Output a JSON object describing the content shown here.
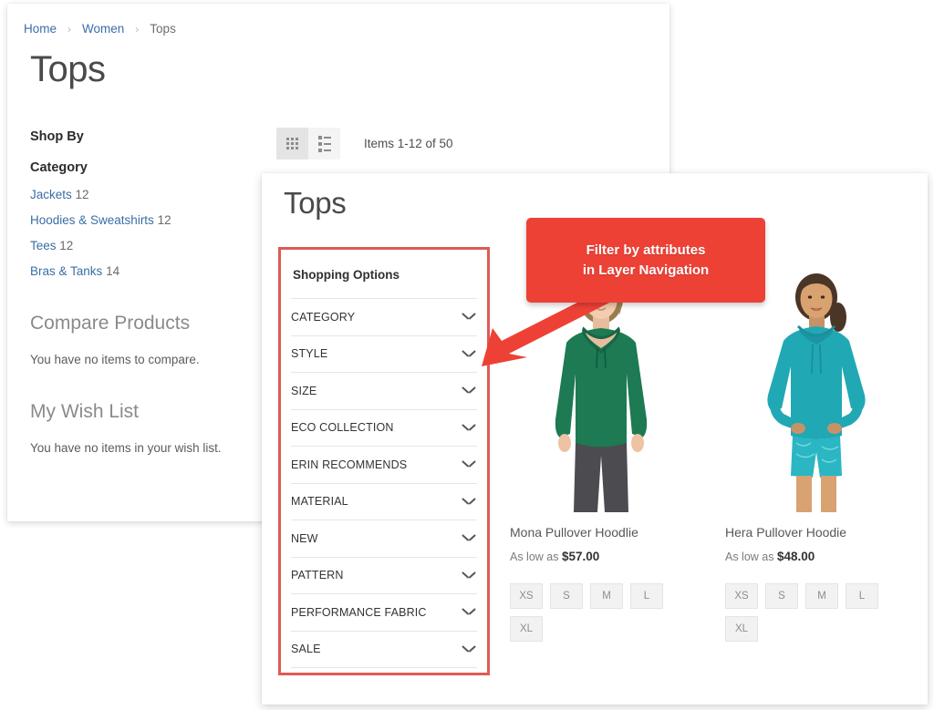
{
  "back_page": {
    "breadcrumb": {
      "items": [
        {
          "label": "Home",
          "type": "link"
        },
        {
          "label": "Women",
          "type": "link"
        },
        {
          "label": "Tops",
          "type": "current"
        }
      ],
      "separator": "›"
    },
    "title": "Tops",
    "sidebar": {
      "shop_by_label": "Shop By",
      "category_label": "Category",
      "categories": [
        {
          "name": "Jackets",
          "count": "12"
        },
        {
          "name": "Hoodies & Sweatshirts",
          "count": "12"
        },
        {
          "name": "Tees",
          "count": "12"
        },
        {
          "name": "Bras & Tanks",
          "count": "14"
        }
      ],
      "compare_title": "Compare Products",
      "compare_empty": "You have no items to compare.",
      "wishlist_title": "My Wish List",
      "wishlist_empty": "You have no items in your wish list."
    },
    "toolbar": {
      "grid_mode_icon": "grid-view-icon",
      "list_mode_icon": "list-view-icon",
      "items_count": "Items 1-12 of 50"
    }
  },
  "front_page": {
    "title": "Tops",
    "filters": {
      "header": "Shopping Options",
      "options": [
        {
          "label": "CATEGORY",
          "icon": "chevron-down-icon"
        },
        {
          "label": "STYLE",
          "icon": "chevron-down-icon"
        },
        {
          "label": "SIZE",
          "icon": "chevron-down-icon"
        },
        {
          "label": "ECO COLLECTION",
          "icon": "chevron-down-icon"
        },
        {
          "label": "ERIN RECOMMENDS",
          "icon": "chevron-down-icon"
        },
        {
          "label": "MATERIAL",
          "icon": "chevron-down-icon"
        },
        {
          "label": "NEW",
          "icon": "chevron-down-icon"
        },
        {
          "label": "PATTERN",
          "icon": "chevron-down-icon"
        },
        {
          "label": "PERFORMANCE FABRIC",
          "icon": "chevron-down-icon"
        },
        {
          "label": "SALE",
          "icon": "chevron-down-icon"
        }
      ],
      "highlight_color": "#e05a55"
    },
    "products": [
      {
        "name": "Mona Pullover Hoodlie",
        "price_prefix": "As low as",
        "price": "$57.00",
        "sizes": [
          "XS",
          "S",
          "M",
          "L",
          "XL"
        ],
        "garment_color": "#1d7a52"
      },
      {
        "name": "Hera Pullover Hoodie",
        "price_prefix": "As low as",
        "price": "$48.00",
        "sizes": [
          "XS",
          "S",
          "M",
          "L",
          "XL"
        ],
        "garment_color": "#21a8b5"
      }
    ]
  },
  "callout": {
    "text": "Filter by attributes\nin Layer Navigation",
    "color": "#ee4136",
    "arrow_icon": "arrow-down-left-icon"
  }
}
